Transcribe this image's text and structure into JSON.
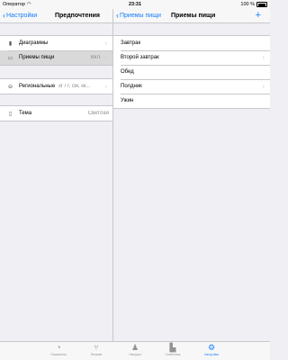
{
  "status_bar": {
    "carrier": "Оператор",
    "time": "23:31",
    "battery": "100 %"
  },
  "left_pane": {
    "nav": {
      "back_label": "Настройки",
      "title": "Предпочтения"
    },
    "rows": [
      {
        "label": "Диаграммы",
        "detail": "",
        "icon": "chart-icon"
      },
      {
        "label": "Приемы пищи",
        "detail": "Вкл.",
        "icon": "meals-icon",
        "selected": true
      },
      {
        "label": "Региональные",
        "detail": "кг / г, см, кк...",
        "icon": "region-icon"
      },
      {
        "label": "Тема",
        "detail": "Светлая",
        "icon": "theme-icon"
      }
    ]
  },
  "right_pane": {
    "nav": {
      "back_label": "Приемы пищи",
      "title": "Приемы пищи",
      "add_label": "+"
    },
    "meals": [
      "Завтрак",
      "Второй завтрак",
      "Обед",
      "Полдник",
      "Ужин"
    ]
  },
  "tab_bar": {
    "tabs": [
      {
        "label": "Показатели",
        "icon": "gauge-icon"
      },
      {
        "label": "Питание",
        "icon": "fork-knife-icon"
      },
      {
        "label": "Нагрузки",
        "icon": "runner-icon"
      },
      {
        "label": "Статистика",
        "icon": "bar-chart-icon"
      },
      {
        "label": "Настройки",
        "icon": "gear-icon",
        "active": true
      }
    ]
  },
  "colors": {
    "accent": "#157efb",
    "selected_row": "#d9d9d9",
    "background": "#efeff4"
  }
}
